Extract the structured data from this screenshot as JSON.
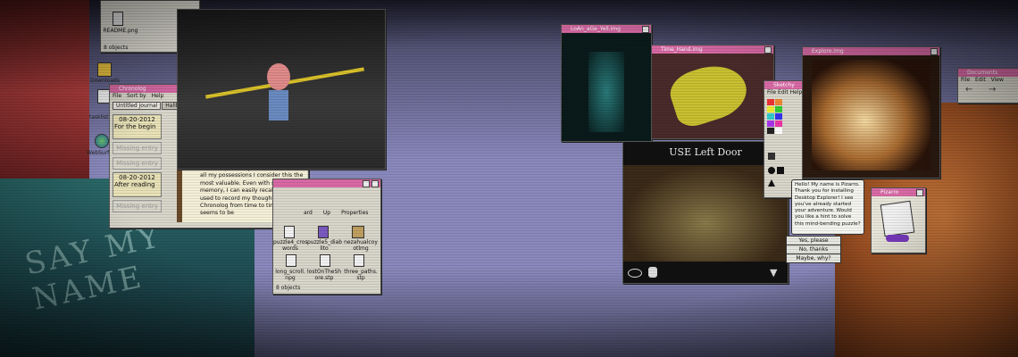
{
  "left_wall": {
    "graffiti": "SAY MY NAME"
  },
  "top_readme": {
    "file": "README.png",
    "status": "8 objects"
  },
  "desktop_icons": [
    {
      "label": "Downloads"
    },
    {
      "label": "tasklist.n"
    },
    {
      "label": "WebSurf"
    }
  ],
  "chronolog": {
    "title": "Chronolog",
    "menu": [
      "File",
      "Sort by",
      "Help"
    ],
    "tabs": [
      "Untitled journal",
      "Halibut's"
    ],
    "entries": [
      {
        "date": "08-20-2012",
        "text": "For the begin"
      },
      {
        "date": "",
        "text": "Missing entry"
      },
      {
        "date": "",
        "text": "Missing entry"
      },
      {
        "date": "08-20-2012",
        "text": "After reading"
      },
      {
        "date": "",
        "text": "Missing entry"
      }
    ],
    "journal_text": "This computer is your inheritance. Of all my possessions I consider this the most valuable. Even with my poor memory, I can easily recall that I used to record my thoughts in Chronolog from time to time. There seems to be"
  },
  "explorer_left": {
    "toolbar": [
      "ard",
      "Up",
      "Properties"
    ],
    "files": [
      {
        "name": "puzzle4_cros\nwords"
      },
      {
        "name": "puzzle5_diab\nlito"
      },
      {
        "name": "nezahualcoy\notlmg"
      },
      {
        "name": "long_scroll.\nnpg"
      },
      {
        "name": "lostOnTheSh\nore.stp"
      },
      {
        "name": "three_paths.\nstp"
      }
    ],
    "status": "8 objects"
  },
  "lea_window": {
    "title": "LoAn_aGe_Yell.img"
  },
  "hand_window": {
    "title": "Time_Hand.img"
  },
  "sketchy": {
    "title": "Sketchy",
    "menu": [
      "File",
      "Edit",
      "Help"
    ]
  },
  "door_game": {
    "caption": "USE Left Door"
  },
  "explore_window": {
    "title": "Explore.img"
  },
  "documents": {
    "title": "Documents",
    "menu": [
      "File",
      "Edit",
      "View"
    ]
  },
  "pizarro": {
    "title": "Pizarro",
    "speech": "Hello! My name is Pizarro. Thank you for installing Desktop Explorer! I see you've already started your adventure. Would you like a hint to solve this mind-bending puzzle?",
    "options": [
      "Yes, please",
      "No, thanks",
      "Maybe, why?"
    ]
  },
  "colors": {
    "titlebar": "#d96aa6",
    "desktop": "#8a89bd",
    "window": "#d9d7cb"
  }
}
